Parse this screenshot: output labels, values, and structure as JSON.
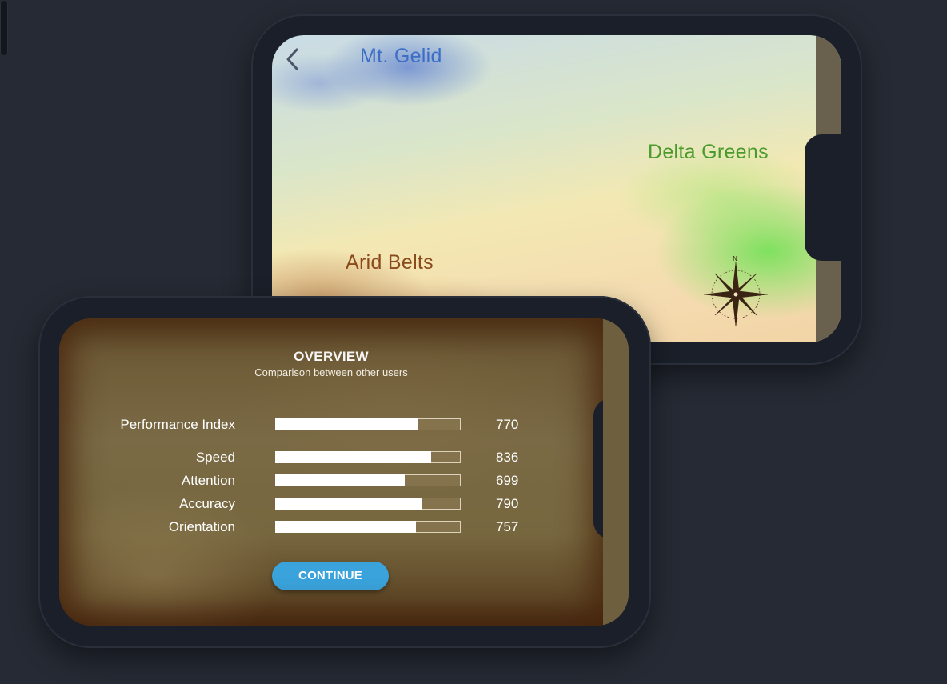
{
  "map_screen": {
    "back_icon": "chevron-left-icon",
    "regions": {
      "mt_gelid": "Mt. Gelid",
      "delta_greens": "Delta Greens",
      "arid_belts": "Arid Belts"
    },
    "compass_icon": "compass-rose-icon",
    "colors": {
      "mt_gelid": "#3c6ec6",
      "delta_greens": "#4a9b2b",
      "arid_belts": "#8a4a1c"
    }
  },
  "overview": {
    "title": "OVERVIEW",
    "subtitle": "Comparison between other users",
    "stats": [
      {
        "label": "Performance Index",
        "value": "770",
        "fill_fraction": 0.77
      },
      {
        "label": "Speed",
        "value": "836",
        "fill_fraction": 0.84
      },
      {
        "label": "Attention",
        "value": "699",
        "fill_fraction": 0.7
      },
      {
        "label": "Accuracy",
        "value": "790",
        "fill_fraction": 0.79
      },
      {
        "label": "Orientation",
        "value": "757",
        "fill_fraction": 0.76
      }
    ],
    "continue_label": "CONTINUE",
    "colors": {
      "continue_button": "#3aa3dc"
    }
  }
}
